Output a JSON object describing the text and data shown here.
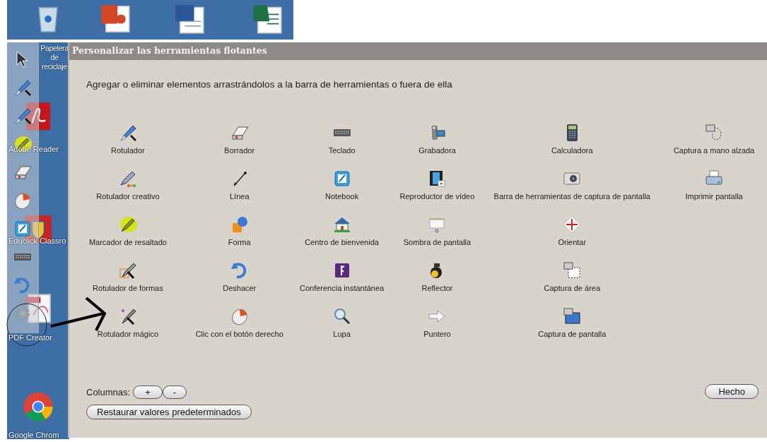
{
  "desktop": {
    "icons": [
      {
        "label": "Papelera de reciclaje",
        "kind": "recycle"
      },
      {
        "label": "Adobe Reader",
        "kind": "pdf-reader"
      },
      {
        "label": "Educlick Classro",
        "kind": "shield"
      },
      {
        "label": "PDF Creator",
        "kind": "pdf-doc"
      },
      {
        "label": "Google Chrom",
        "kind": "browser"
      }
    ]
  },
  "dialog": {
    "title": "Personalizar las herramientas flotantes",
    "instruction": "Agregar o eliminar elementos arrastrándolos a la barra de herramientas o fuera de ella",
    "tool_columns": [
      [
        {
          "label": "Rotulador",
          "kind": "pen"
        },
        {
          "label": "Rotulador creativo",
          "kind": "creative-pen"
        },
        {
          "label": "Marcador de resaltado",
          "kind": "highlighter"
        },
        {
          "label": "Rotulador de formas",
          "kind": "shape-pen"
        },
        {
          "label": "Rotulador mágico",
          "kind": "magic-pen"
        }
      ],
      [
        {
          "label": "Borrador",
          "kind": "eraser"
        },
        {
          "label": "Línea",
          "kind": "line"
        },
        {
          "label": "Forma",
          "kind": "shape"
        },
        {
          "label": "Deshacer",
          "kind": "undo"
        },
        {
          "label": "Clic con el botón derecho",
          "kind": "mouse"
        }
      ],
      [
        {
          "label": "Teclado",
          "kind": "keyboard"
        },
        {
          "label": "Notebook",
          "kind": "notebook"
        },
        {
          "label": "Centro de bienvenida",
          "kind": "house"
        },
        {
          "label": "Conferencia instantánea",
          "kind": "conference"
        },
        {
          "label": "Lupa",
          "kind": "magnifier"
        }
      ],
      [
        {
          "label": "Grabadora",
          "kind": "camcorder"
        },
        {
          "label": "Reproductor de vídeo",
          "kind": "film"
        },
        {
          "label": "Sombra de pantalla",
          "kind": "screen"
        },
        {
          "label": "Reflector",
          "kind": "spotlight"
        },
        {
          "label": "Puntero",
          "kind": "pointer"
        }
      ],
      [
        {
          "label": "Calculadora",
          "kind": "calculator"
        },
        {
          "label": "Barra de herramientas de captura de pantalla",
          "kind": "camera"
        },
        {
          "label": "Orientar",
          "kind": "orient"
        },
        {
          "label": "Captura de área",
          "kind": "area-capture"
        },
        {
          "label": "Captura de pantalla",
          "kind": "screen-capture"
        }
      ],
      [
        {
          "label": "Captura a mano alzada",
          "kind": "freehand-capture"
        },
        {
          "label": "Imprimir pantalla",
          "kind": "printer"
        }
      ]
    ],
    "columns_label": "Columnas:",
    "plus_button": "+",
    "minus_button": "-",
    "restore_button": "Restaurar valores predeterminados",
    "done_button": "Hecho"
  }
}
